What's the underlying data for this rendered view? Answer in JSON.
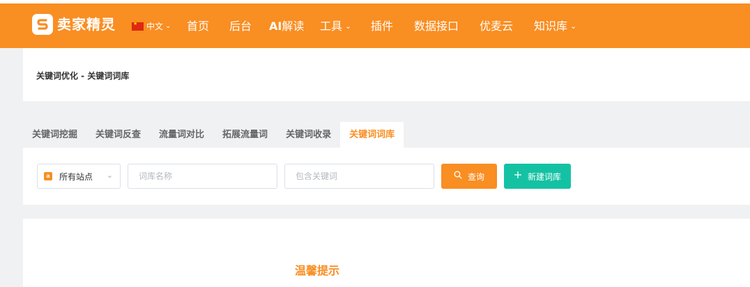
{
  "brand": {
    "name": "卖家精灵",
    "accent": "#f98e22",
    "teal": "#14c2a3"
  },
  "language": {
    "label": "中文",
    "flag": "cn-flag"
  },
  "nav": {
    "home": "首页",
    "backend": "后台",
    "ai_prefix": "AI",
    "ai_rest": "解读",
    "tools": "工具",
    "plugins": "插件",
    "api": "数据接口",
    "cloud": "优麦云",
    "knowledge": "知识库"
  },
  "breadcrumb": "关键词优化 - 关键词词库",
  "tabs": [
    {
      "label": "关键词挖掘",
      "active": false
    },
    {
      "label": "关键词反查",
      "active": false
    },
    {
      "label": "流量词对比",
      "active": false
    },
    {
      "label": "拓展流量词",
      "active": false
    },
    {
      "label": "关键词收录",
      "active": false
    },
    {
      "label": "关键词词库",
      "active": true
    }
  ],
  "filters": {
    "site_select": "所有站点",
    "library_name_placeholder": "词库名称",
    "keyword_placeholder": "包含关键词",
    "query_label": "查询",
    "new_label": "新建词库"
  },
  "tip": {
    "title": "温馨提示"
  }
}
